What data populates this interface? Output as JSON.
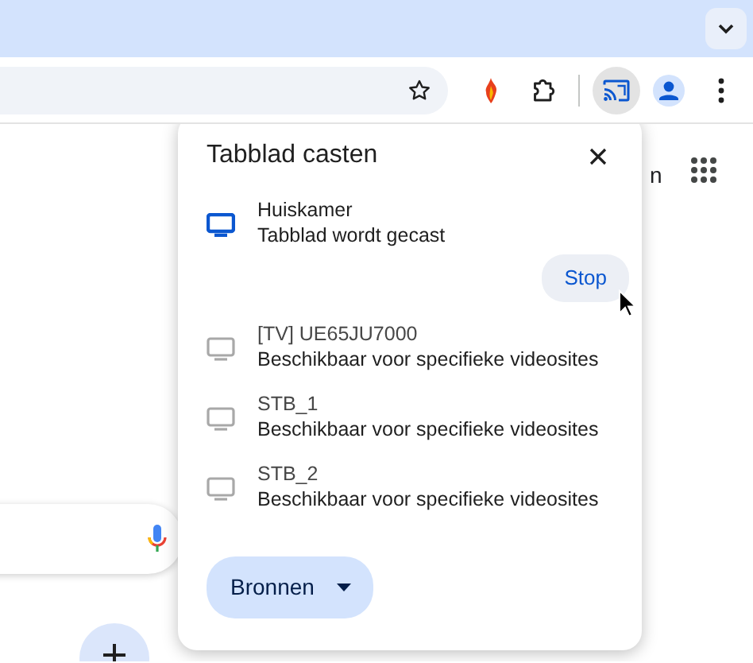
{
  "toolbar": {
    "cast_button": {
      "selected": true
    }
  },
  "page": {
    "header_text_fragment": "n"
  },
  "cast_dialog": {
    "title": "Tabblad casten",
    "devices": [
      {
        "name": "Huiskamer",
        "status": "Tabblad wordt gecast",
        "active": true,
        "action": "Stop"
      },
      {
        "name": "[TV] UE65JU7000",
        "status": "Beschikbaar voor specifieke videosites",
        "active": false
      },
      {
        "name": "STB_1",
        "status": "Beschikbaar voor specifieke videosites",
        "active": false
      },
      {
        "name": "STB_2",
        "status": "Beschikbaar voor specifieke videosites",
        "active": false
      }
    ],
    "sources_button": "Bronnen"
  }
}
